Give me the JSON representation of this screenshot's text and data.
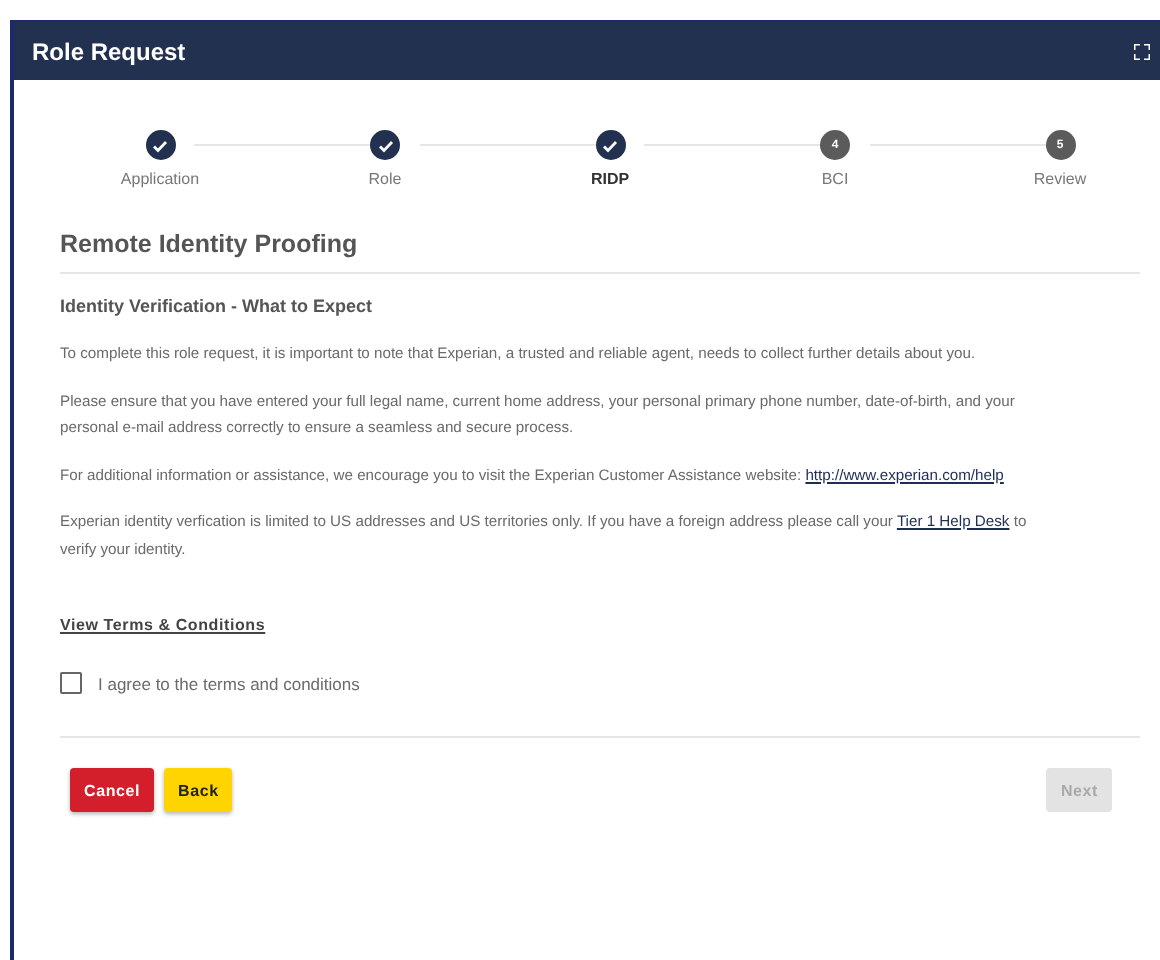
{
  "window": {
    "title": "Role Request"
  },
  "steps": [
    {
      "label": "Application",
      "done": true,
      "selected": false
    },
    {
      "label": "Role",
      "done": true,
      "selected": false
    },
    {
      "label": "RIDP",
      "done": true,
      "selected": true
    },
    {
      "label": "BCI",
      "done": false,
      "selected": false,
      "number": "4"
    },
    {
      "label": "Review",
      "done": false,
      "selected": false,
      "number": "5"
    }
  ],
  "section_title": "Remote Identity Proofing",
  "subtitle": "Identity Verification - What to Expect",
  "paragraphs": [
    [
      {
        "kind": "text",
        "text": "To complete this role request, it is important to note that Experian, a trusted and reliable agent, needs to collect further details about you."
      }
    ],
    [
      {
        "kind": "text",
        "text": "Please ensure that you have entered your full legal name, current home address, your personal primary phone number, date-of-birth, and your personal e-mail address correctly to ensure a seamless and secure process."
      }
    ],
    [
      {
        "kind": "text",
        "text": "For additional information or assistance, we encourage you to visit the Experian Customer Assistance website: "
      },
      {
        "kind": "link",
        "text": "http://www.experian.com/help"
      }
    ],
    [
      {
        "kind": "text",
        "text": "Experian identity verfication is limited to US addresses and US territories only. If you have a foreign address please call your "
      },
      {
        "kind": "link",
        "text": "Tier 1 Help Desk"
      },
      {
        "kind": "text",
        "text": " to verify your identity."
      }
    ]
  ],
  "terms_link": "View Terms & Conditions",
  "agree": {
    "label": "I agree to the terms and conditions",
    "checked": false
  },
  "buttons": [
    {
      "kind": "cancel",
      "label": "Cancel",
      "disabled": false
    },
    {
      "kind": "back",
      "label": "Back",
      "disabled": false
    },
    {
      "kind": "next",
      "label": "Next",
      "disabled": true
    }
  ]
}
